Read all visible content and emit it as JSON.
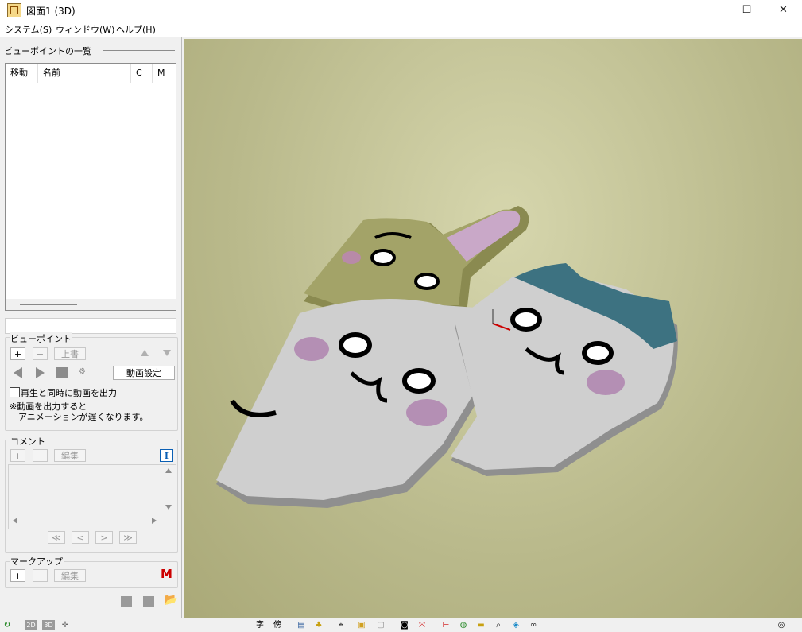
{
  "window": {
    "title": "図面1 (3D)",
    "minimize": "—",
    "maximize": "☐",
    "close": "✕"
  },
  "menu": [
    "システム(S)",
    "ウィンドウ(W)",
    "ヘルプ(H)"
  ],
  "viewpoint_list": {
    "title": "ビューポイントの一覧",
    "columns": [
      "移動",
      "名前",
      "C",
      "M"
    ]
  },
  "viewpoint": {
    "title": "ビューポイント",
    "add": "+",
    "remove": "−",
    "overwrite": "上書",
    "video_settings": "動画設定",
    "checkbox_label": "再生と同時に動画を出力",
    "note_line1": "※動画を出力すると",
    "note_line2": "アニメーションが遅くなります。"
  },
  "comment": {
    "title": "コメント",
    "add": "+",
    "remove": "−",
    "edit": "編集",
    "text_tool": "I",
    "nav": [
      "≪",
      "<",
      ">",
      "≫"
    ]
  },
  "markup": {
    "title": "マークアップ",
    "add": "+",
    "remove": "−",
    "edit": "編集",
    "markup_icon": "M"
  },
  "statusbar": {
    "char": "字",
    "side": "傍",
    "2d": "2D",
    "3d": "3D"
  },
  "colors": {
    "viewport_bg": "#bcbc90",
    "accent_red": "#cc0000",
    "selection": "#0a5fb4"
  }
}
